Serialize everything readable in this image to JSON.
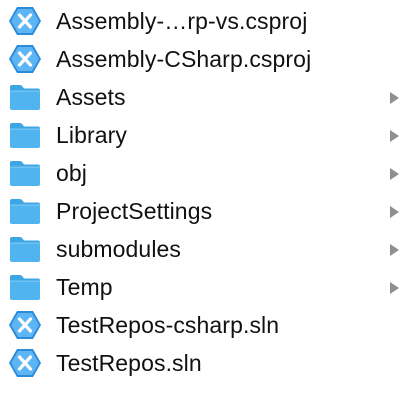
{
  "items": [
    {
      "name": "Assembly-…rp-vs.csproj",
      "icon": "visual-studio-project-icon",
      "kind": "project-file",
      "has_children": false
    },
    {
      "name": "Assembly-CSharp.csproj",
      "icon": "visual-studio-project-icon",
      "kind": "project-file",
      "has_children": false
    },
    {
      "name": "Assets",
      "icon": "folder-icon",
      "kind": "folder",
      "has_children": true
    },
    {
      "name": "Library",
      "icon": "folder-icon",
      "kind": "folder",
      "has_children": true
    },
    {
      "name": "obj",
      "icon": "folder-icon",
      "kind": "folder",
      "has_children": true
    },
    {
      "name": "ProjectSettings",
      "icon": "folder-icon",
      "kind": "folder",
      "has_children": true
    },
    {
      "name": "submodules",
      "icon": "folder-icon",
      "kind": "folder",
      "has_children": true
    },
    {
      "name": "Temp",
      "icon": "folder-icon",
      "kind": "folder",
      "has_children": true
    },
    {
      "name": "TestRepos-csharp.sln",
      "icon": "visual-studio-solution-icon",
      "kind": "solution-file",
      "has_children": false
    },
    {
      "name": "TestRepos.sln",
      "icon": "visual-studio-solution-icon",
      "kind": "solution-file",
      "has_children": false
    }
  ],
  "colors": {
    "folder_body": "#4fb4ef",
    "folder_tab": "#3da6e6",
    "vs_hex_outer": "#2a8ad8",
    "vs_hex_inner": "#5eb5f5",
    "chevron": "#8e8e93",
    "text": "#111111"
  }
}
